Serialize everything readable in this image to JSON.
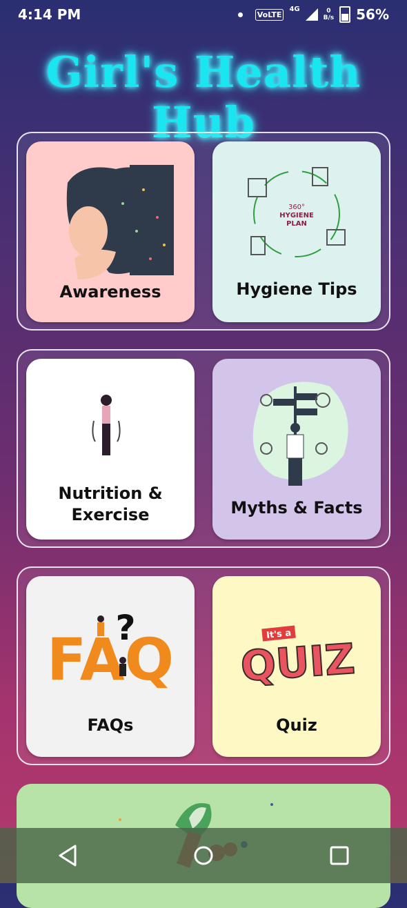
{
  "status": {
    "time": "4:14 PM",
    "volte": "VoLTE",
    "network": "4G",
    "speed_value": "0",
    "speed_unit": "B/s",
    "battery": "56%"
  },
  "app": {
    "title": "Girl's Health Hub"
  },
  "cards": {
    "awareness": {
      "label": "Awareness",
      "bg": "#ffcccb"
    },
    "hygiene": {
      "label": "Hygiene Tips",
      "bg": "#ddf1ef",
      "illus_line1": "360°",
      "illus_line2": "HYGIENE",
      "illus_line3": "PLAN"
    },
    "nutrition": {
      "label_line1": "Nutrition &",
      "label_line2": "Exercise",
      "bg": "#ffffff"
    },
    "myths": {
      "label": "Myths & Facts",
      "bg": "#d3c5ea"
    },
    "faqs": {
      "label": "FAQs",
      "bg": "#f2f2f2",
      "illus_text": "FAQ"
    },
    "quiz": {
      "label": "Quiz",
      "bg": "#fef9c4",
      "illus_small": "It's a",
      "illus_big": "QUIZ"
    }
  },
  "colors": {
    "title": "#19e6f0",
    "bottom_card": "#b8e3a7"
  },
  "nav": {
    "back_icon": "triangle-back-icon",
    "home_icon": "home-icon",
    "recents_icon": "square-recents-icon"
  }
}
